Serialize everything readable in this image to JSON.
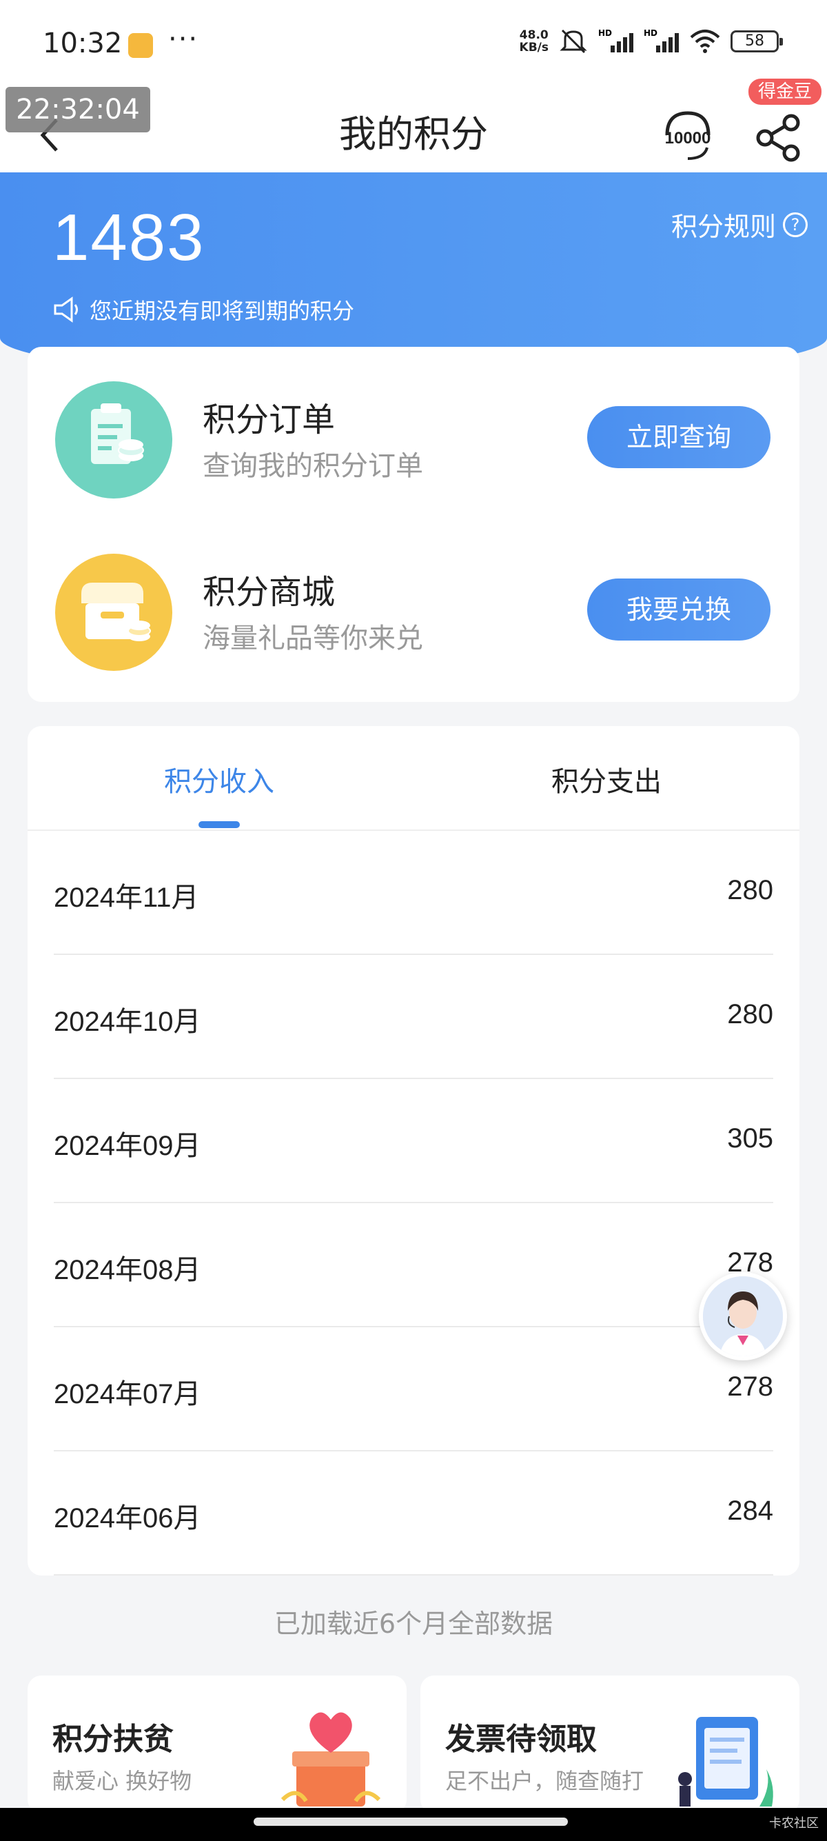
{
  "status_bar": {
    "time": "10:32",
    "more": "···",
    "net_speed_value": "48.0",
    "net_speed_unit": "KB/s",
    "battery": "58"
  },
  "clock_overlay": "22:32:04",
  "header": {
    "title": "我的积分",
    "hotline_label": "10000",
    "badge": "得金豆"
  },
  "points": {
    "value": "1483",
    "rules_label": "积分规则",
    "rules_icon": "?",
    "expire_note": "您近期没有即将到期的积分"
  },
  "actions": [
    {
      "title": "积分订单",
      "subtitle": "查询我的积分订单",
      "button": "立即查询",
      "icon": "clipboard-coin-icon",
      "color": "#6fd3c0"
    },
    {
      "title": "积分商城",
      "subtitle": "海量礼品等你来兑",
      "button": "我要兑换",
      "icon": "shop-coin-icon",
      "color": "#f7c84a"
    }
  ],
  "tabs": [
    {
      "label": "积分收入",
      "active": true
    },
    {
      "label": "积分支出",
      "active": false
    }
  ],
  "records": [
    {
      "month": "2024年11月",
      "value": "280"
    },
    {
      "month": "2024年10月",
      "value": "280"
    },
    {
      "month": "2024年09月",
      "value": "305"
    },
    {
      "month": "2024年08月",
      "value": "278"
    },
    {
      "month": "2024年07月",
      "value": "278"
    },
    {
      "month": "2024年06月",
      "value": "284"
    }
  ],
  "loaded_note": "已加载近6个月全部数据",
  "promos": [
    {
      "title": "积分扶贫",
      "subtitle": "献爱心 换好物"
    },
    {
      "title": "发票待领取",
      "subtitle": "足不出户，随查随打"
    }
  ],
  "watermark": "卡农社区",
  "colors": {
    "accent": "#3d86e8",
    "banner": "#4a8ff0",
    "badge": "#f25d5d"
  }
}
